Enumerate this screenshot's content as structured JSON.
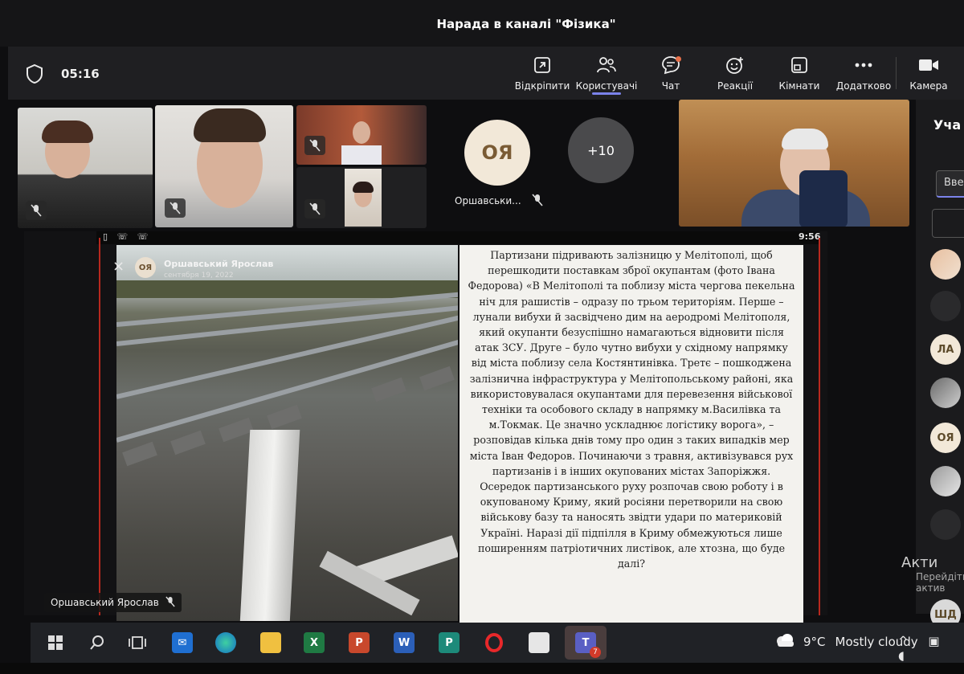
{
  "window": {
    "title": "Нарада в каналі \"Фізика\""
  },
  "toolbar": {
    "timer": "05:16",
    "items": [
      {
        "label": "Відкріпити",
        "icon": "popout-icon"
      },
      {
        "label": "Користувачі",
        "icon": "people-icon"
      },
      {
        "label": "Чат",
        "icon": "chat-icon"
      },
      {
        "label": "Реакції",
        "icon": "reactions-icon"
      },
      {
        "label": "Кімнати",
        "icon": "rooms-icon"
      },
      {
        "label": "Додатково",
        "icon": "more-icon"
      },
      {
        "label": "Камера",
        "icon": "camera-icon"
      }
    ]
  },
  "participants": {
    "avatar_initials": "ОЯ",
    "avatar_name": "Оршавськи...",
    "more_count": "+10"
  },
  "side_panel": {
    "title": "Уча",
    "search_value": "Вве",
    "avatars": [
      "ЛА",
      "ОЯ",
      "ШД"
    ],
    "activate_line1": "Акти",
    "activate_line2": "Перейдіть",
    "activate_line3": "актив"
  },
  "shared_screen": {
    "phone_time": "9:56",
    "post_author": "Оршавський Ярослав",
    "post_author_initials": "ОЯ",
    "post_date": "сентября 19, 2022",
    "presenter_name": "Оршавський Ярослав",
    "article_text": "Партизани підривають залізницю у Мелітополі, щоб перешкодити поставкам зброї окупантам (фото Івана Федорова) «В Мелітополі та поблизу міста чергова пекельна ніч для рашистів – одразу по трьом територіям. Перше – лунали вибухи й засвідчено дим на аеродромі Мелітополя, який окупанти безуспішно намагаються відновити після атак ЗСУ. Друге – було чутно вибухи у східному напрямку від міста поблизу села Костянтинівка. Третє – пошкоджена залізнична інфраструктура у Мелітопольському районі, яка використовувалася окупантами для перевезення військової техніки та особового складу в напрямку м.Василівка та м.Токмак. Це значно ускладнює логістику ворога», – розповідав кілька днів тому про один з таких випадків мер міста Іван Федоров. Починаючи з травня, активізувався рух партизанів і в інших окупованих містах Запоріжжя. Осередок партизанського руху розпочав свою роботу і в окупованому Криму, який росіяни перетворили на свою військову базу та наносять звідти удари по материковій Україні. Наразі дії підпілля в Криму обмежуються лише поширенням патріотичних листівок, але хтозна, що буде далі?"
  },
  "taskbar": {
    "icons": [
      "windows-icon",
      "search-icon",
      "task-view-icon",
      "mail-icon",
      "edge-icon",
      "explorer-icon",
      "excel-icon",
      "powerpoint-icon",
      "word-icon",
      "publisher-icon",
      "opera-icon",
      "store-icon",
      "teams-icon"
    ],
    "teams_badge": "7",
    "temperature": "9°C",
    "weather": "Mostly cloudy"
  },
  "colors": {
    "accent": "#7b83eb",
    "background": "#0e0e10",
    "toolbar": "#1f1f22",
    "red_border": "#b8281e"
  }
}
